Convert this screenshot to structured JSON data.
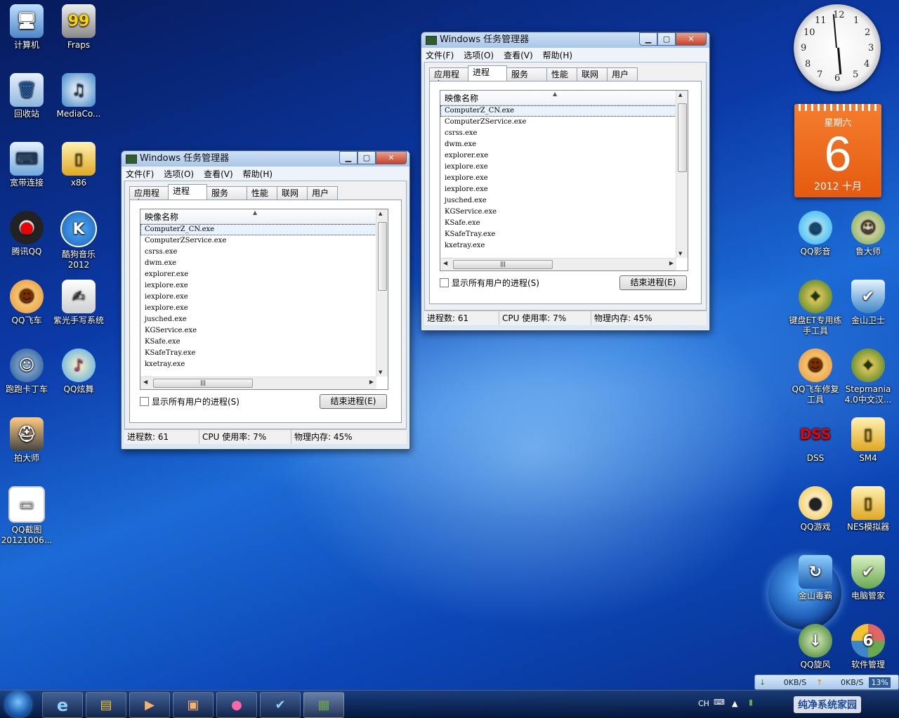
{
  "desktop_icons_left": [
    {
      "label": "计算机",
      "icon": "computer-icon",
      "color": "#6fa8dc"
    },
    {
      "label": "Fraps",
      "icon": "fraps-icon",
      "color": "#ffd400"
    },
    {
      "label": "回收站",
      "icon": "recycle-bin-icon",
      "color": "#b7d7f0"
    },
    {
      "label": "MediaCo...",
      "icon": "mediacoder-icon",
      "color": "#3d85c6"
    },
    {
      "label": "宽带连接",
      "icon": "broadband-icon",
      "color": "#9fc5e8"
    },
    {
      "label": "x86",
      "icon": "folder-icon",
      "color": "#f1c232"
    },
    {
      "label": "腾讯QQ",
      "icon": "qq-penguin-icon",
      "color": "#222222"
    },
    {
      "label": "酷狗音乐 2012",
      "icon": "kugou-icon",
      "color": "#1c7ed6"
    },
    {
      "label": "QQ飞车",
      "icon": "qq-speed-icon",
      "color": "#e69138"
    },
    {
      "label": "紫光手写系统",
      "icon": "handwriting-icon",
      "color": "#dddddd"
    },
    {
      "label": "跑跑卡丁车",
      "icon": "kartrider-icon",
      "color": "#3c78d8"
    },
    {
      "label": "QQ炫舞",
      "icon": "qq-dance-icon",
      "color": "#ffd966"
    },
    {
      "label": "拍大师",
      "icon": "paidashi-icon",
      "color": "#f6b26b"
    },
    {
      "label": "QQ截图 20121006...",
      "icon": "screenshot-file-icon",
      "color": "#ffffff"
    }
  ],
  "desktop_icons_right": [
    {
      "label": "QQ影音",
      "icon": "qq-player-icon",
      "color": "#2ab0e8"
    },
    {
      "label": "鲁大师",
      "icon": "ludashi-icon",
      "color": "#6aa84f"
    },
    {
      "label": "键盘ET专用练手工具",
      "icon": "keyboard-et-icon",
      "color": "#38761d"
    },
    {
      "label": "金山卫士",
      "icon": "kingsoft-guard-icon",
      "color": "#3d85c6"
    },
    {
      "label": "QQ飞车修复工具",
      "icon": "qq-speed-repair-icon",
      "color": "#e69138"
    },
    {
      "label": "Stepmania 4.0中文汉...",
      "icon": "stepmania-icon",
      "color": "#38761d"
    },
    {
      "label": "DSS",
      "icon": "dss-icon",
      "color": "#cc0000"
    },
    {
      "label": "SM4",
      "icon": "folder-icon",
      "color": "#f1c232"
    },
    {
      "label": "QQ游戏",
      "icon": "qq-game-icon",
      "color": "#f1c232"
    },
    {
      "label": "NES模拟器",
      "icon": "folder-icon",
      "color": "#f1c232"
    },
    {
      "label": "金山毒霸",
      "icon": "kingsoft-antivirus-icon",
      "color": "#1c7ed6"
    },
    {
      "label": "电脑管家",
      "icon": "pc-manager-icon",
      "color": "#6aa84f"
    },
    {
      "label": "QQ旋风",
      "icon": "qq-whirlwind-icon",
      "color": "#6aa84f"
    },
    {
      "label": "软件管理",
      "icon": "software-manager-icon",
      "color": "#e06666"
    }
  ],
  "clock_gadget": {
    "numbers": [
      "12",
      "1",
      "2",
      "3",
      "4",
      "5",
      "6",
      "7",
      "8",
      "9",
      "10",
      "11"
    ]
  },
  "calendar_gadget": {
    "weekday": "星期六",
    "day": "6",
    "year_month": "2012 十月"
  },
  "task_manager": {
    "title": "Windows 任务管理器",
    "menu": [
      "文件(F)",
      "选项(O)",
      "查看(V)",
      "帮助(H)"
    ],
    "tabs": [
      "应用程序",
      "进程",
      "服务",
      "性能",
      "联网",
      "用户"
    ],
    "active_tab": "进程",
    "column_header": "映像名称",
    "processes": [
      "ComputerZ_CN.exe",
      "ComputerZService.exe",
      "csrss.exe",
      "dwm.exe",
      "explorer.exe",
      "iexplore.exe",
      "iexplore.exe",
      "iexplore.exe",
      "jusched.exe",
      "KGService.exe",
      "KSafe.exe",
      "KSafeTray.exe",
      "kxetray.exe",
      "…"
    ],
    "show_all_users": "显示所有用户的进程(S)",
    "end_process": "结束进程(E)",
    "status_processes": "进程数: 61",
    "status_cpu": "CPU 使用率: 7%",
    "status_memory": "物理内存: 45%"
  },
  "net_meter": {
    "down": "0KB/S",
    "up": "0KB/S",
    "percent": "13%"
  },
  "taskbar": {
    "buttons": [
      "ie-icon",
      "explorer-folder-icon",
      "media-player-icon",
      "network-icon",
      "osu-icon",
      "kingsoft-guard-icon",
      "task-manager-icon"
    ],
    "tray_lang": "CH",
    "watermark": "纯净系统家园"
  }
}
